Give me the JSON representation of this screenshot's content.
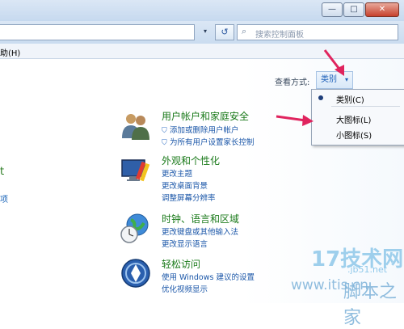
{
  "window": {
    "buttons": [
      "—",
      "□",
      "✕"
    ]
  },
  "address": {
    "search_placeholder": "搜索控制面板",
    "refresh_glyph": "↺",
    "dropdown_glyph": "▾"
  },
  "menubar": {
    "help_fragment": "助(H)"
  },
  "viewby": {
    "label": "查看方式:",
    "selected": "类别",
    "caret": "▾",
    "options": [
      "类别(C)",
      "大图标(L)",
      "小图标(S)"
    ]
  },
  "left_fragments": {
    "heading_tail": "t",
    "link_tail": "项"
  },
  "categories": [
    {
      "title": "用户帐户和家庭安全",
      "links": [
        "添加或删除用户帐户",
        "为所有用户设置家长控制"
      ]
    },
    {
      "title": "外观和个性化",
      "links": [
        "更改主题",
        "更改桌面背景",
        "调整屏幕分辨率"
      ]
    },
    {
      "title": "时钟、语言和区域",
      "links": [
        "更改键盘或其他输入法",
        "更改显示语言"
      ]
    },
    {
      "title": "轻松访问",
      "links": [
        "使用 Windows 建议的设置",
        "优化视频显示"
      ]
    }
  ],
  "watermark": {
    "logo": "17技术网",
    "url": ".jb51.net",
    "site": "www.itis.cn",
    "brand": "脚本之家"
  }
}
